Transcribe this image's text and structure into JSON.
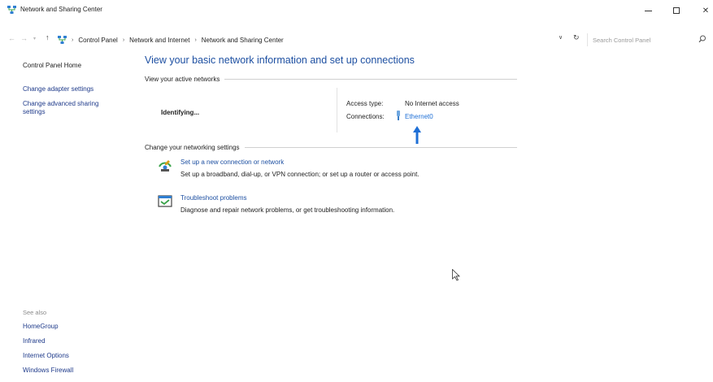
{
  "window": {
    "title": "Network and Sharing Center",
    "controls": {
      "minimize": "–",
      "maximize": "☐",
      "close": "✕"
    }
  },
  "address": {
    "back": "←",
    "forward": "→",
    "recent": "▾",
    "up": "↑",
    "breadcrumbs": [
      "Control Panel",
      "Network and Internet",
      "Network and Sharing Center"
    ],
    "separator": "›",
    "dropdown": "∨",
    "refresh": "↻",
    "search_placeholder": "Search Control Panel"
  },
  "sidebar": {
    "home": "Control Panel Home",
    "adapter": "Change adapter settings",
    "sharing": "Change advanced sharing settings",
    "see_also_title": "See also",
    "see_also": [
      "HomeGroup",
      "Infrared",
      "Internet Options",
      "Windows Firewall"
    ]
  },
  "main": {
    "title": "View your basic network information and set up connections",
    "active_heading": "View your active networks",
    "network_name": "Identifying...",
    "access_type_label": "Access type:",
    "access_type_value": "No Internet access",
    "connections_label": "Connections:",
    "connection_link": "Ethernet0",
    "change_heading": "Change your networking settings",
    "tasks": [
      {
        "icon": "setup-connection-icon",
        "link": "Set up a new connection or network",
        "desc": "Set up a broadband, dial-up, or VPN connection; or set up a router or access point."
      },
      {
        "icon": "troubleshoot-icon",
        "link": "Troubleshoot problems",
        "desc": "Diagnose and repair network problems, or get troubleshooting information."
      }
    ]
  },
  "colors": {
    "link": "#1e50a2",
    "accent": "#1e6fd6",
    "arrow": "#1e6fd6"
  }
}
